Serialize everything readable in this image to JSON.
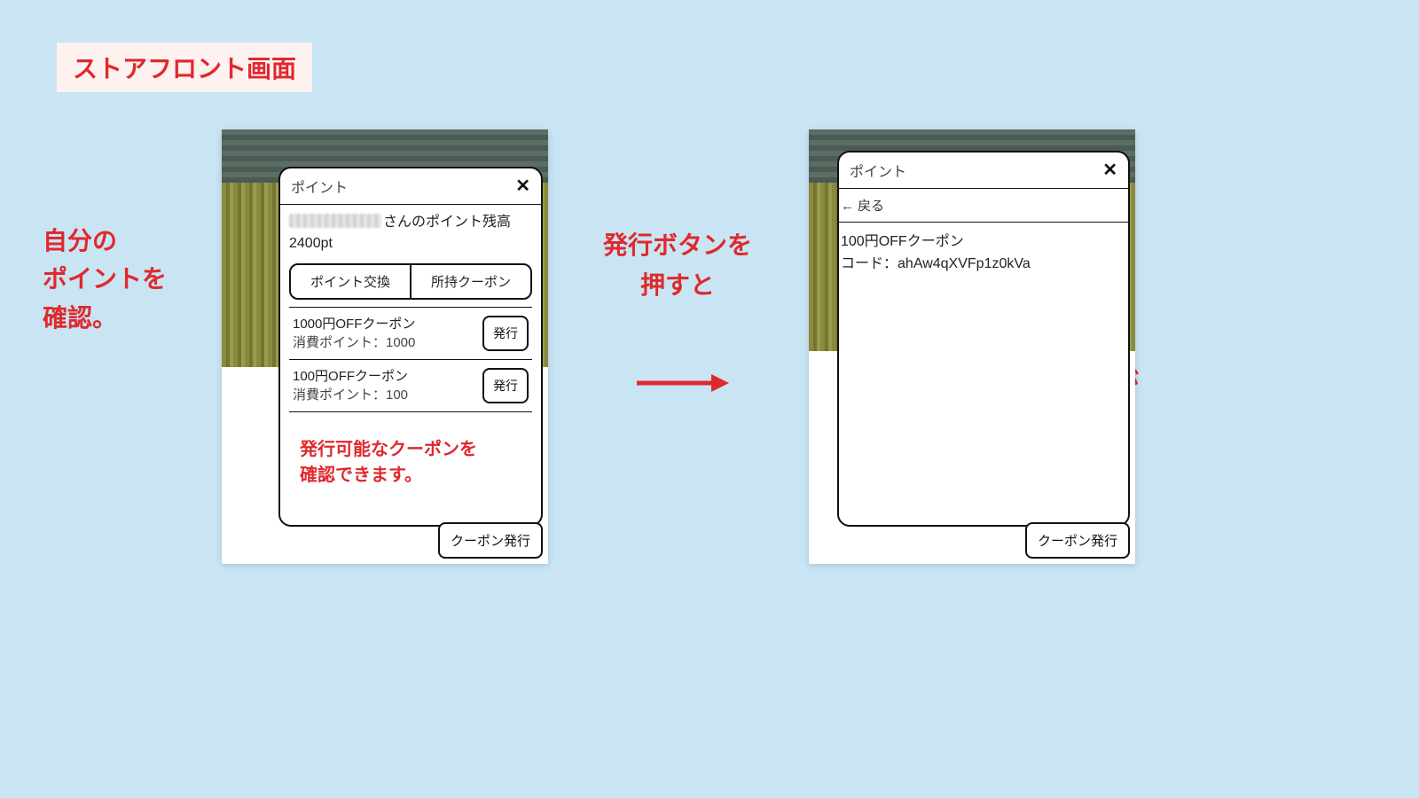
{
  "title": "ストアフロント画面",
  "left_note": "自分の\nポイントを\n確認。",
  "mid_note": "発行ボタンを\n押すと",
  "right_caption": "クーポンコードが\n発行されます。",
  "inner_caption": "発行可能なクーポンを\n確認できます。",
  "arrow_glyph": "→",
  "panelA": {
    "dialog_title": "ポイント",
    "close": "✕",
    "balance_suffix": "さんのポイント残高",
    "balance_value": "2400pt",
    "tab_exchange": "ポイント交換",
    "tab_owned": "所持クーポン",
    "coupons": [
      {
        "name": "1000円OFFクーポン",
        "cost": "消費ポイント：1000",
        "action": "発行"
      },
      {
        "name": "100円OFFクーポン",
        "cost": "消費ポイント：100",
        "action": "発行"
      }
    ],
    "footer_button": "クーポン発行"
  },
  "panelB": {
    "dialog_title": "ポイント",
    "close": "✕",
    "back": "戻る",
    "coupon_name": "100円OFFクーポン",
    "code_label": "コード：",
    "code_value": "ahAw4qXVFp1z0kVa",
    "footer_button": "クーポン発行"
  }
}
